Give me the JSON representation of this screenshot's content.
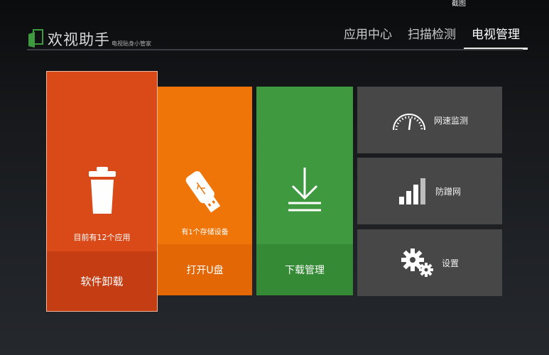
{
  "topbar": {
    "screenshot_label": "截图"
  },
  "header": {
    "title": "欢视助手",
    "subtitle": "电视贴身小管家",
    "tabs": [
      {
        "label": "应用中心",
        "active": false
      },
      {
        "label": "扫描检测",
        "active": false
      },
      {
        "label": "电视管理",
        "active": true
      }
    ]
  },
  "tiles": {
    "uninstall": {
      "caption": "目前有12个应用",
      "label": "软件卸载",
      "icon": "trash-icon",
      "color": "#d94a18"
    },
    "usb": {
      "caption": "有1个存储设备",
      "label": "打开U盘",
      "icon": "usb-drive-icon",
      "color": "#f07508"
    },
    "download": {
      "label": "下载管理",
      "icon": "download-icon",
      "color": "#3f9a3f"
    },
    "speed": {
      "label": "网速监测",
      "icon": "speedometer-icon",
      "color": "#474747"
    },
    "leech": {
      "label": "防蹭网",
      "icon": "signal-bars-icon",
      "color": "#474747"
    },
    "settings": {
      "label": "设置",
      "icon": "gears-icon",
      "color": "#474747"
    }
  }
}
